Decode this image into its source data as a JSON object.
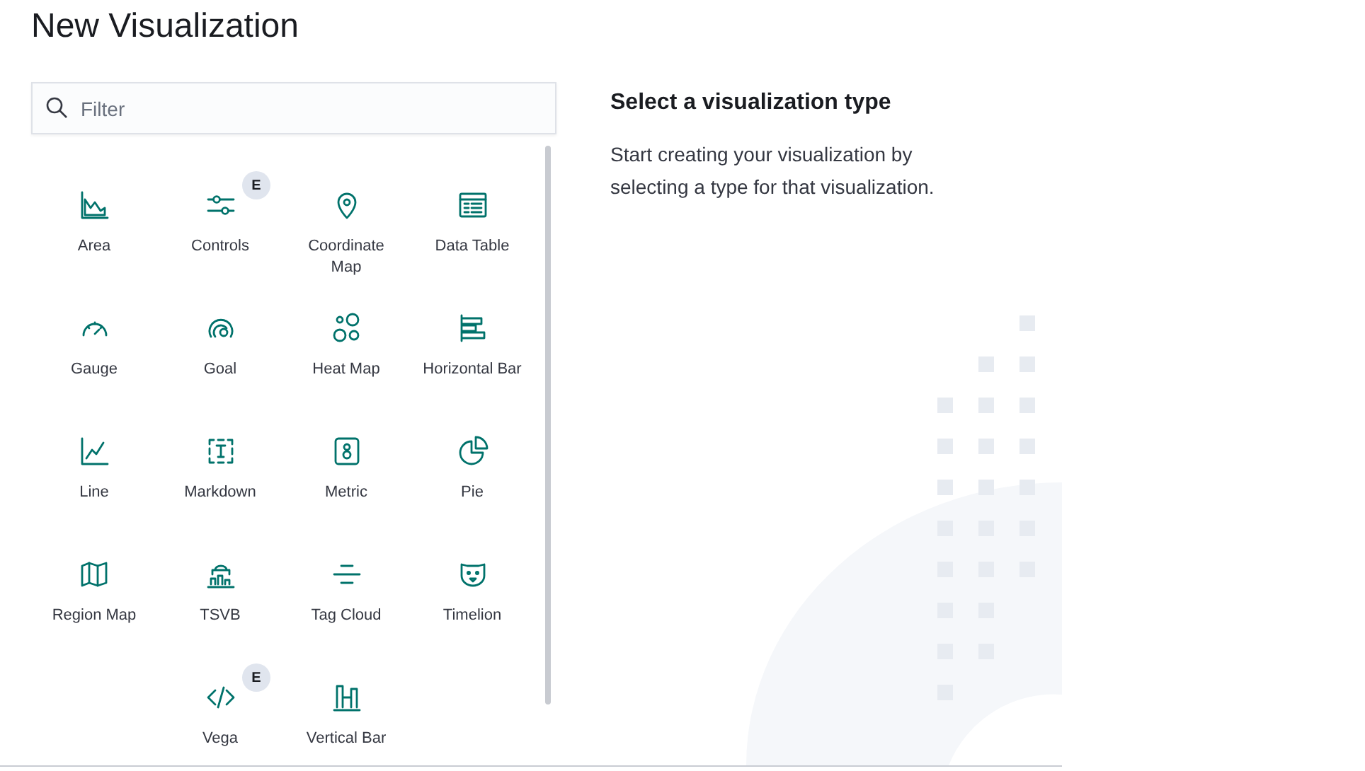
{
  "title": "New Visualization",
  "search": {
    "placeholder": "Filter"
  },
  "types": [
    {
      "label": "Area"
    },
    {
      "label": "Controls",
      "badge": "E"
    },
    {
      "label": "Coordinate Map"
    },
    {
      "label": "Data Table"
    },
    {
      "label": "Gauge"
    },
    {
      "label": "Goal"
    },
    {
      "label": "Heat Map"
    },
    {
      "label": "Horizontal Bar"
    },
    {
      "label": "Line"
    },
    {
      "label": "Markdown"
    },
    {
      "label": "Metric"
    },
    {
      "label": "Pie"
    },
    {
      "label": "Region Map"
    },
    {
      "label": "TSVB"
    },
    {
      "label": "Tag Cloud"
    },
    {
      "label": "Timelion"
    },
    {
      "label": "Vega",
      "badge": "E"
    },
    {
      "label": "Vertical Bar"
    }
  ],
  "description": {
    "heading": "Select a visualization type",
    "text": "Start creating your visualization by selecting a type for that visualization."
  }
}
